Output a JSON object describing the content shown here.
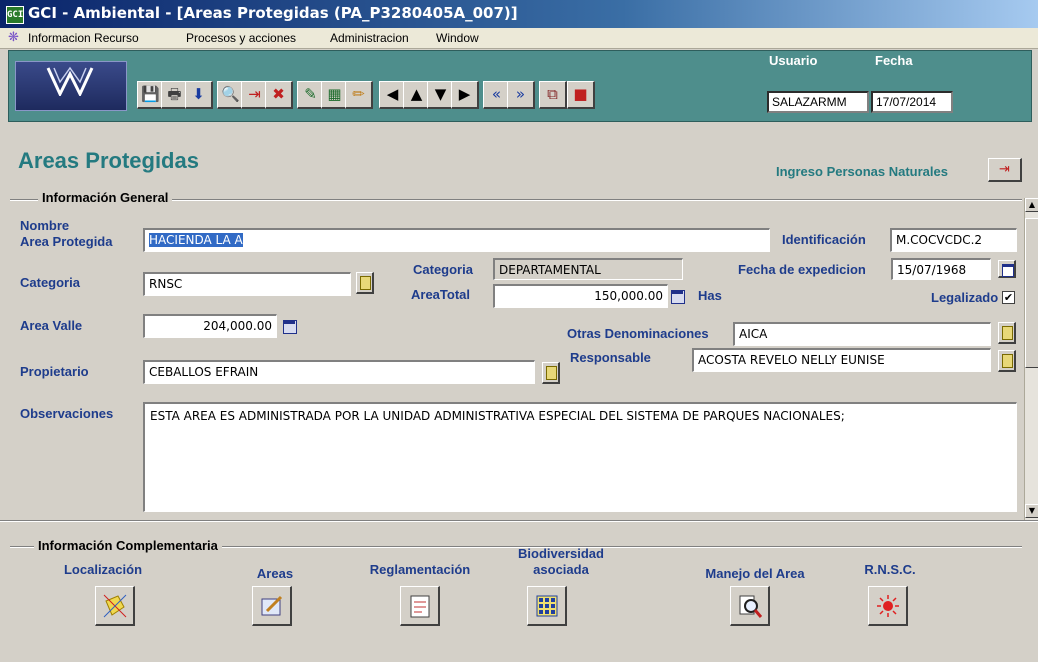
{
  "window": {
    "title": "GCI - Ambiental - [Areas Protegidas (PA_P3280405A_007)]",
    "app_icon_text": "GCI"
  },
  "menu": {
    "items": [
      "Informacion Recurso",
      "Procesos y acciones",
      "Administracion",
      "Window"
    ]
  },
  "toolbar": {
    "user_label": "Usuario",
    "user_value": "SALAZARMM",
    "date_label": "Fecha",
    "date_value": "17/07/2014",
    "buttons": [
      {
        "name": "save-icon",
        "glyph": "💾"
      },
      {
        "name": "print-icon",
        "glyph": "🖶"
      },
      {
        "name": "download-icon",
        "glyph": "⬇"
      },
      {
        "name": "query-icon",
        "glyph": "🔍"
      },
      {
        "name": "insert-record-icon",
        "glyph": "⇥"
      },
      {
        "name": "delete-record-icon",
        "glyph": "✖"
      },
      {
        "name": "clear-icon",
        "glyph": "✎"
      },
      {
        "name": "view-icon",
        "glyph": "▦"
      },
      {
        "name": "edit-icon",
        "glyph": "✏"
      },
      {
        "name": "previous-icon",
        "glyph": "◀"
      },
      {
        "name": "up-icon",
        "glyph": "▲"
      },
      {
        "name": "down-icon",
        "glyph": "▼"
      },
      {
        "name": "next-icon",
        "glyph": "▶"
      },
      {
        "name": "first-icon",
        "glyph": "«"
      },
      {
        "name": "last-icon",
        "glyph": "»"
      },
      {
        "name": "copy-icon",
        "glyph": "⧉"
      },
      {
        "name": "exit-icon",
        "glyph": "■"
      }
    ]
  },
  "page": {
    "title": "Areas Protegidas",
    "ingreso_link": "Ingreso Personas Naturales"
  },
  "general": {
    "section_title": "Información General",
    "nombre_label_1": "Nombre",
    "nombre_label_2": "Area Protegida",
    "nombre_value": "HACIENDA LA A",
    "identificacion_label": "Identificación",
    "identificacion_value": "M.COCVCDC.2",
    "categoria_label": "Categoria",
    "categoria_value": "RNSC",
    "categoria2_label": "Categoria",
    "categoria2_value": "DEPARTAMENTAL",
    "fecha_exp_label": "Fecha de expedicion",
    "fecha_exp_value": "15/07/1968",
    "areatotal_label": "AreaTotal",
    "areatotal_value": "150,000.00",
    "has_label": "Has",
    "legalizado_label": "Legalizado",
    "legalizado_checked": "✔",
    "area_valle_label": "Area Valle",
    "area_valle_value": "204,000.00",
    "otras_label": "Otras Denominaciones",
    "otras_value": "AICA",
    "propietario_label": "Propietario",
    "propietario_value": "CEBALLOS  EFRAIN",
    "responsable_label": "Responsable",
    "responsable_value": "ACOSTA REVELO NELLY EUNISE",
    "observaciones_label": "Observaciones",
    "observaciones_value": "ESTA AREA ES ADMINISTRADA POR LA UNIDAD ADMINISTRATIVA ESPECIAL DEL SISTEMA DE PARQUES NACIONALES;"
  },
  "complementaria": {
    "section_title": "Información Complementaria",
    "buttons": [
      {
        "label": "Localización",
        "label2": ""
      },
      {
        "label": "Areas",
        "label2": ""
      },
      {
        "label": "Reglamentación",
        "label2": ""
      },
      {
        "label": "Biodiversidad",
        "label2": "asociada"
      },
      {
        "label": "Manejo del Area",
        "label2": ""
      },
      {
        "label": "R.N.S.C.",
        "label2": ""
      }
    ]
  }
}
